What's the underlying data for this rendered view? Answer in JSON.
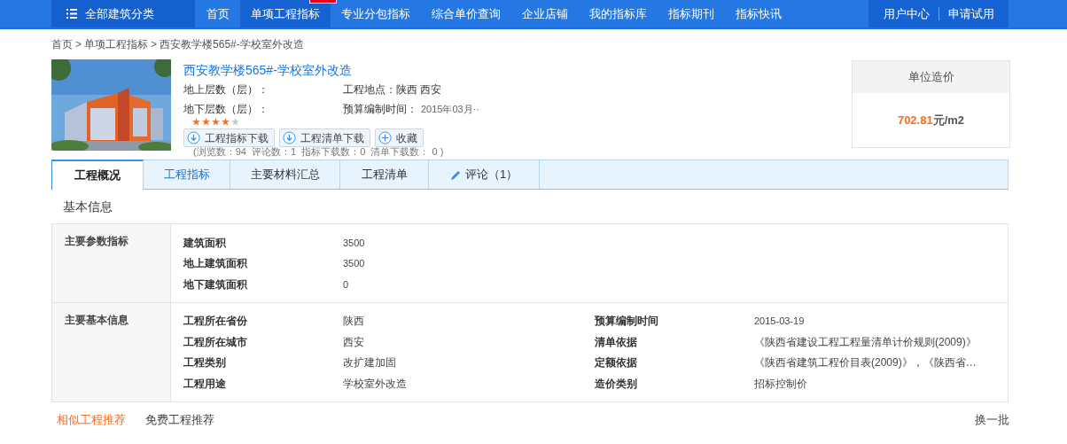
{
  "nav": {
    "category": "全部建筑分类",
    "items": [
      {
        "label": "首页",
        "selected": false,
        "badge": false
      },
      {
        "label": "单项工程指标",
        "selected": true,
        "badge": true
      },
      {
        "label": "专业分包指标",
        "selected": false,
        "badge": false
      },
      {
        "label": "综合单价查询",
        "selected": false,
        "badge": false
      },
      {
        "label": "企业店铺",
        "selected": false,
        "badge": false
      },
      {
        "label": "我的指标库",
        "selected": false,
        "badge": false
      },
      {
        "label": "指标期刊",
        "selected": false,
        "badge": false
      },
      {
        "label": "指标快讯",
        "selected": false,
        "badge": false
      }
    ],
    "user_links": [
      "用户中心",
      "申请试用"
    ]
  },
  "breadcrumb": [
    "首页",
    "单项工程指标",
    "西安教学楼565#-学校室外改造"
  ],
  "breadcrumb_separator": ">",
  "project": {
    "title": "西安教学楼565#-学校室外改造",
    "fields": [
      {
        "label": "地上层数（层）："
      },
      {
        "label": "工程地点：",
        "value": "陕西 西安"
      },
      {
        "label": "地下层数（层）："
      },
      {
        "label": "预算编制时间：",
        "value": "2015年03月··"
      }
    ],
    "stars": 4,
    "buttons": [
      {
        "label": "工程指标下载",
        "kind": "download"
      },
      {
        "label": "工程清单下载",
        "kind": "download"
      },
      {
        "label": "收藏",
        "kind": "add"
      }
    ],
    "stats": "(浏览数：94  评论数：1  指标下载数：0  清单下载数： 0 )"
  },
  "unit_price": {
    "title": "单位造价",
    "value": "702.81",
    "unit": "元/m2"
  },
  "tabs": [
    {
      "label": "工程概况",
      "selected": true,
      "icon": false
    },
    {
      "label": "工程指标",
      "selected": false,
      "icon": false
    },
    {
      "label": "主要材料汇总",
      "selected": false,
      "icon": false
    },
    {
      "label": "工程清单",
      "selected": false,
      "icon": false
    },
    {
      "label": "评论（1）",
      "selected": false,
      "icon": true
    }
  ],
  "section_title": "基本信息",
  "groups": [
    {
      "heading": "主要参数指标",
      "rows": [
        {
          "label": "建筑面积",
          "value": "3500"
        },
        {
          "label": "地上建筑面积",
          "value": "3500"
        },
        {
          "label": "地下建筑面积",
          "value": "0"
        }
      ]
    },
    {
      "heading": "主要基本信息",
      "rows": [
        {
          "label": "工程所在省份",
          "value": "陕西",
          "label_2": "预算编制时间",
          "value_2": "2015-03-19"
        },
        {
          "label": "工程所在城市",
          "value": "西安",
          "label_2": "清单依据",
          "value_2": "《陕西省建设工程工程量清单计价规则(2009)》"
        },
        {
          "label": "工程类别",
          "value": "改扩建加固",
          "label_2": "定额依据",
          "value_2": "《陕西省建筑工程价目表(2009)》，《陕西省…"
        },
        {
          "label": "工程用途",
          "value": "学校室外改造",
          "label_2": "造价类别",
          "value_2": "招标控制价"
        }
      ]
    }
  ],
  "recommend_tabs": [
    {
      "label": "相似工程推荐",
      "selected": true
    },
    {
      "label": "免费工程推荐",
      "selected": false
    }
  ],
  "refresh": "换一批"
}
